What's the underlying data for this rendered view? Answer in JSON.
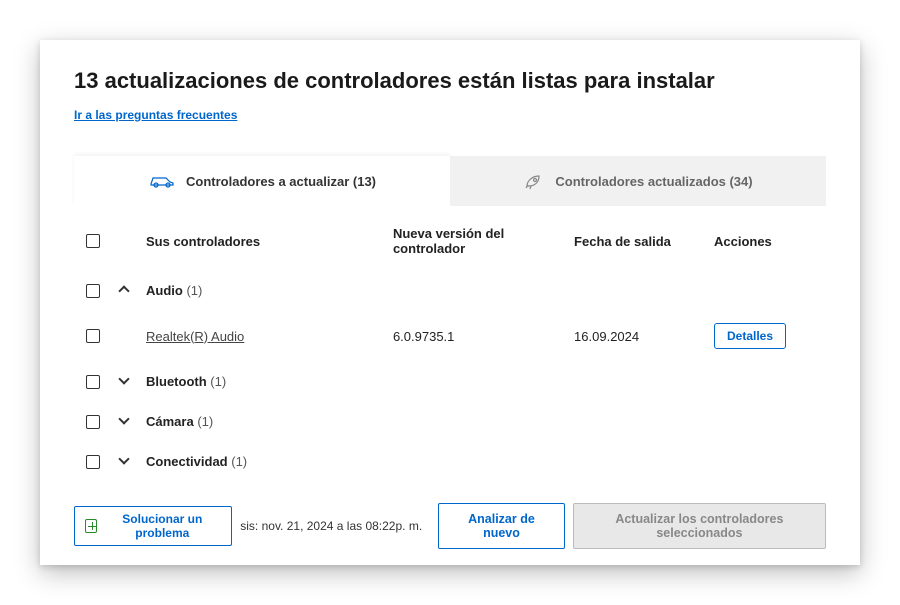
{
  "header": {
    "title": "13 actualizaciones de controladores están listas para instalar",
    "faq_link": "Ir a las preguntas frecuentes"
  },
  "tabs": {
    "update_label": "Controladores a actualizar (13)",
    "updated_label": "Controladores actualizados (34)"
  },
  "columns": {
    "name": "Sus controladores",
    "version": "Nueva versión del controlador",
    "date": "Fecha de salida",
    "actions": "Acciones"
  },
  "groups": [
    {
      "name": "Audio",
      "count": "(1)",
      "expanded": true
    },
    {
      "name": "Bluetooth",
      "count": "(1)",
      "expanded": false
    },
    {
      "name": "Cámara",
      "count": "(1)",
      "expanded": false
    },
    {
      "name": "Conectividad",
      "count": "(1)",
      "expanded": false
    }
  ],
  "driver": {
    "name": "Realtek(R) Audio",
    "version": "6.0.9735.1",
    "date": "16.09.2024",
    "details_label": "Detalles"
  },
  "footer": {
    "fix_label": "Solucionar un problema",
    "scan_info": "sis: nov. 21, 2024 a las 08:22p. m.",
    "rescan_label": "Analizar de nuevo",
    "update_label": "Actualizar los controladores seleccionados"
  }
}
